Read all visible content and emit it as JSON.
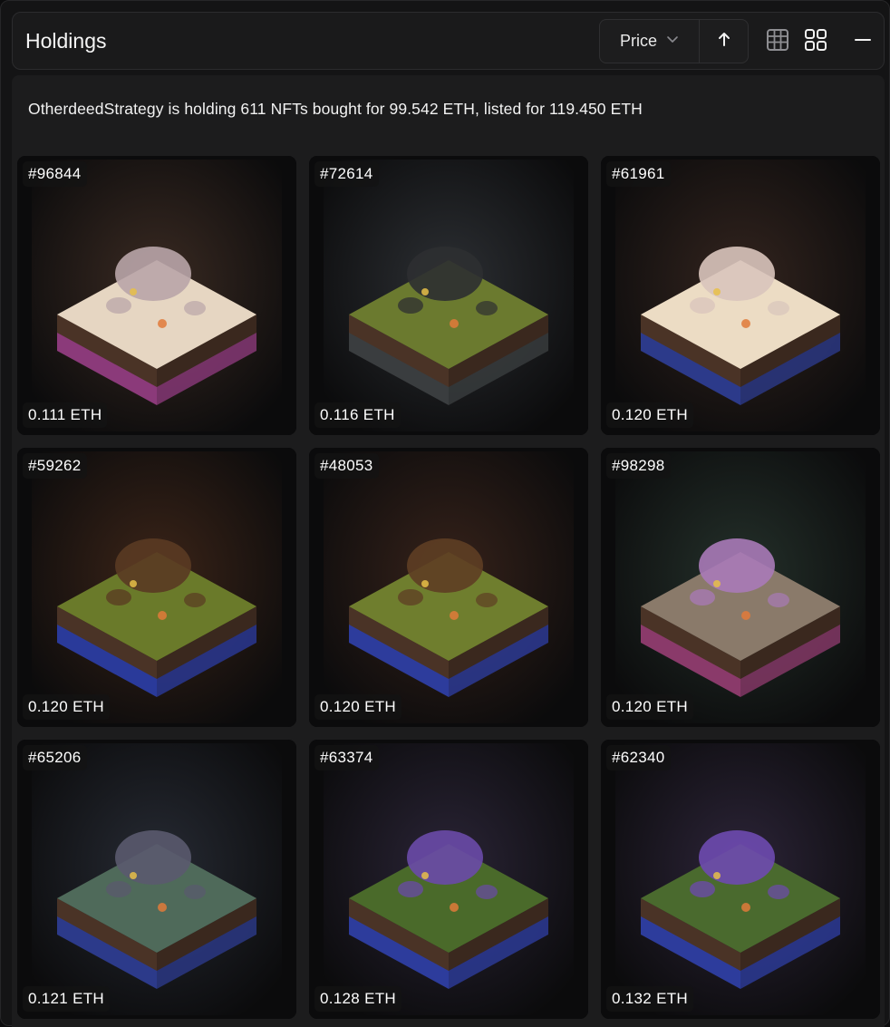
{
  "header": {
    "title": "Holdings",
    "sort_label": "Price",
    "sort_icon": "chevron-down-icon",
    "direction_icon": "arrow-up-icon",
    "view_icons": [
      "table-view-icon",
      "grid-view-icon"
    ],
    "collapse_icon": "minus-icon"
  },
  "summary": {
    "text": "OtherdeedStrategy is holding 611 NFTs bought for 99.542 ETH, listed for 119.450 ETH"
  },
  "theme": {
    "panel_bg": "#141415",
    "card_badge_bg": "#141414"
  },
  "cards": [
    {
      "id": "#96844",
      "price": "0.111 ETH",
      "bg": "#3a2a22",
      "top": "#e6d6c2",
      "side": "#8b3a7a",
      "accent": "#b9a5a8"
    },
    {
      "id": "#72614",
      "price": "0.116 ETH",
      "bg": "#2c2f33",
      "top": "#6b7a2f",
      "side": "#3a3d3f",
      "accent": "#2e2f31"
    },
    {
      "id": "#61961",
      "price": "0.120 ETH",
      "bg": "#33241e",
      "top": "#ecdcc4",
      "side": "#2c3a8a",
      "accent": "#d9c4bc"
    },
    {
      "id": "#59262",
      "price": "0.120 ETH",
      "bg": "#3b2418",
      "top": "#6a7a2a",
      "side": "#2a3a9a",
      "accent": "#5a3a22"
    },
    {
      "id": "#48053",
      "price": "0.120 ETH",
      "bg": "#36221a",
      "top": "#6f7e2e",
      "side": "#2d3c9c",
      "accent": "#5e3e24"
    },
    {
      "id": "#98298",
      "price": "0.120 ETH",
      "bg": "#24302a",
      "top": "#8a7a6a",
      "side": "#8a3a6a",
      "accent": "#a87ab8"
    },
    {
      "id": "#65206",
      "price": "0.121 ETH",
      "bg": "#262a33",
      "top": "#4f6a5a",
      "side": "#2c3a8a",
      "accent": "#5a5a6e"
    },
    {
      "id": "#63374",
      "price": "0.128 ETH",
      "bg": "#2a2436",
      "top": "#4a6a2a",
      "side": "#2d3c9c",
      "accent": "#6a4aa8"
    },
    {
      "id": "#62340",
      "price": "0.132 ETH",
      "bg": "#2c2438",
      "top": "#4a6a2e",
      "side": "#2d3c9c",
      "accent": "#6e4ab0"
    }
  ]
}
